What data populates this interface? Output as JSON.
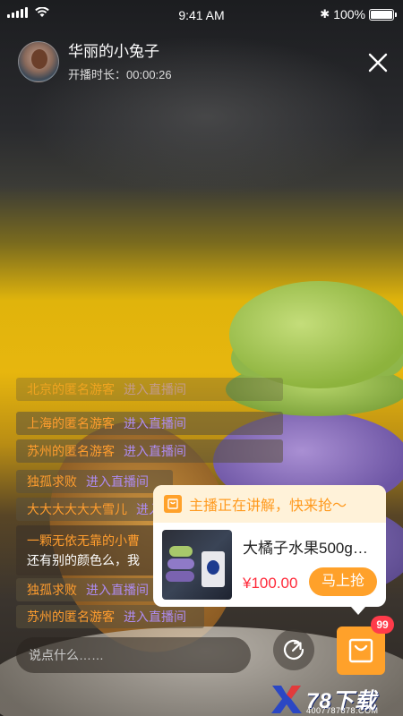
{
  "status_bar": {
    "time": "9:41 AM",
    "battery": "100%"
  },
  "host": {
    "name": "华丽的小兔子",
    "duration_label": "开播时长：",
    "duration": "00:00:26"
  },
  "chat": {
    "messages": [
      {
        "user": "北京的匿名游客",
        "action": "进入直播间"
      },
      {
        "user": "上海的匿名游客",
        "action": "进入直播间"
      },
      {
        "user": "苏州的匿名游客",
        "action": "进入直播间"
      },
      {
        "user": "独孤求败",
        "action": "进入直播间"
      },
      {
        "user": "大大大大大大雪儿",
        "action": "进入直播间"
      },
      {
        "user": "一颗无依无靠的小曹",
        "content": "还有别的颜色么，我"
      },
      {
        "user": "独孤求败",
        "action": "进入直播间"
      },
      {
        "user": "苏州的匿名游客",
        "action": "进入直播间"
      }
    ]
  },
  "input": {
    "placeholder": "说点什么……"
  },
  "cart": {
    "badge": "99"
  },
  "popup": {
    "header": "主播正在讲解，快来抢～",
    "product_name": "大橘子水果500g…",
    "price": "¥100.00",
    "buy_label": "马上抢"
  },
  "watermark": {
    "brand": "78下载",
    "sub": "4007787878.COM"
  },
  "colors": {
    "accent": "#ffa12a",
    "username": "#ff9d2e",
    "action": "#ae8cf2",
    "price": "#ff2a3a",
    "badge": "#ff3b4a"
  }
}
